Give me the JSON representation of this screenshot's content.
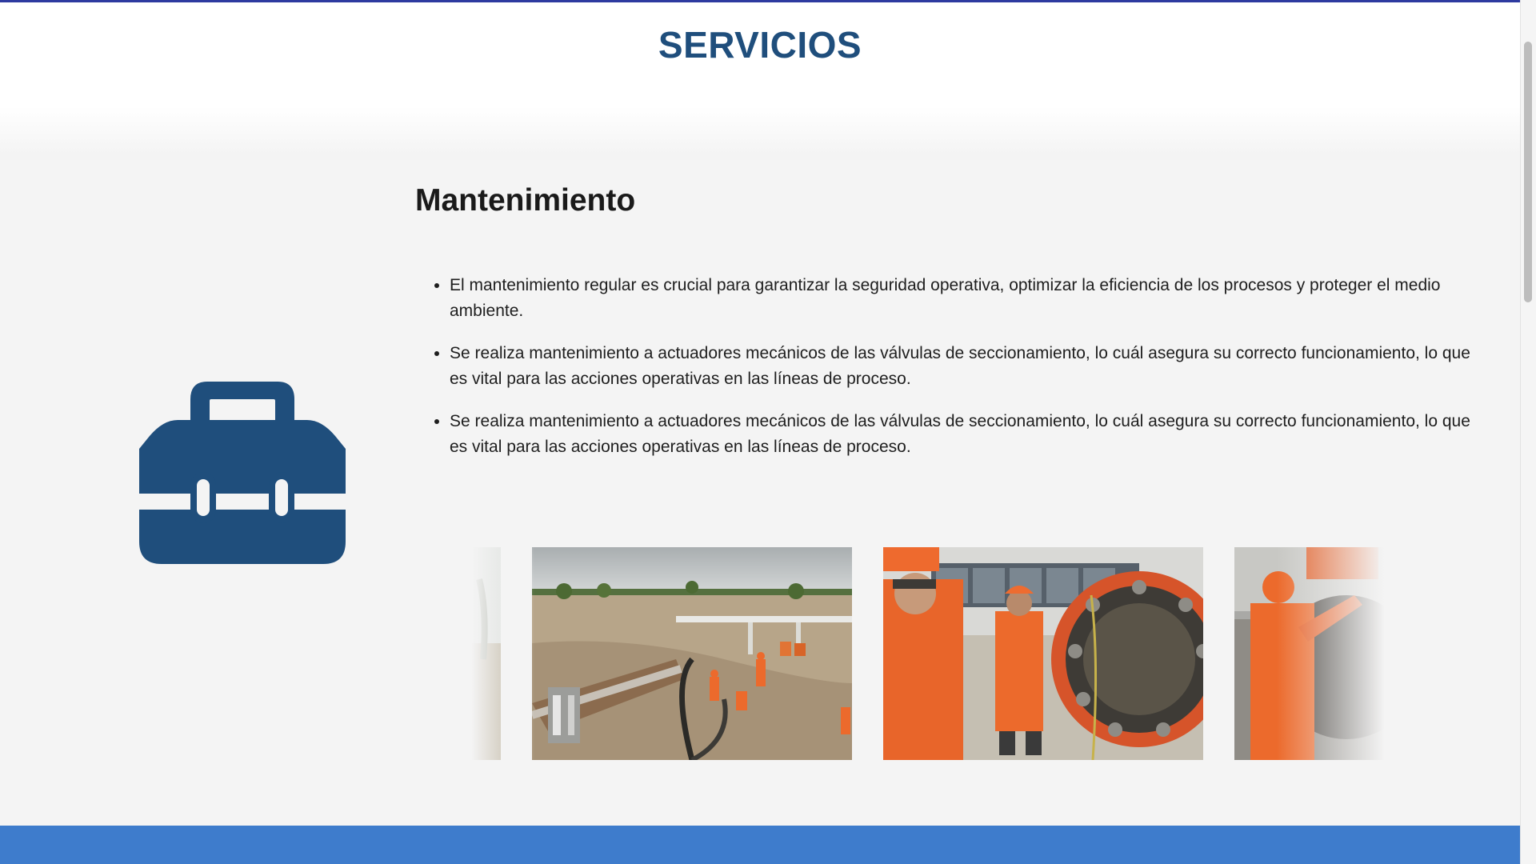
{
  "section": {
    "title": "SERVICIOS"
  },
  "service": {
    "icon": "toolbox-icon",
    "heading": "Mantenimiento",
    "bullets": [
      "El mantenimiento regular es crucial para garantizar la seguridad operativa, optimizar la eficiencia de los procesos y proteger el medio ambiente.",
      "Se realiza mantenimiento a actuadores mecánicos de las válvulas de seccionamiento, lo cuál asegura su correcto funcionamiento, lo que es vital para las acciones operativas en las líneas de proceso.",
      "Se realiza mantenimiento a actuadores mecánicos de las válvulas de seccionamiento, lo cuál asegura su correcto funcionamiento, lo que es vital para las acciones operativas en las líneas de proceso."
    ]
  },
  "carousel": {
    "images": [
      "pipeline-site-photo-partial",
      "pipeline-excavation-photo",
      "flange-maintenance-photo",
      "valve-worker-photo-partial"
    ]
  },
  "colors": {
    "title_blue": "#1f4e7c",
    "icon_blue": "#1f4e7c",
    "footer_blue": "#3e7ccc",
    "top_border": "#2e3aa0",
    "worker_orange": "#ec6a2c"
  }
}
